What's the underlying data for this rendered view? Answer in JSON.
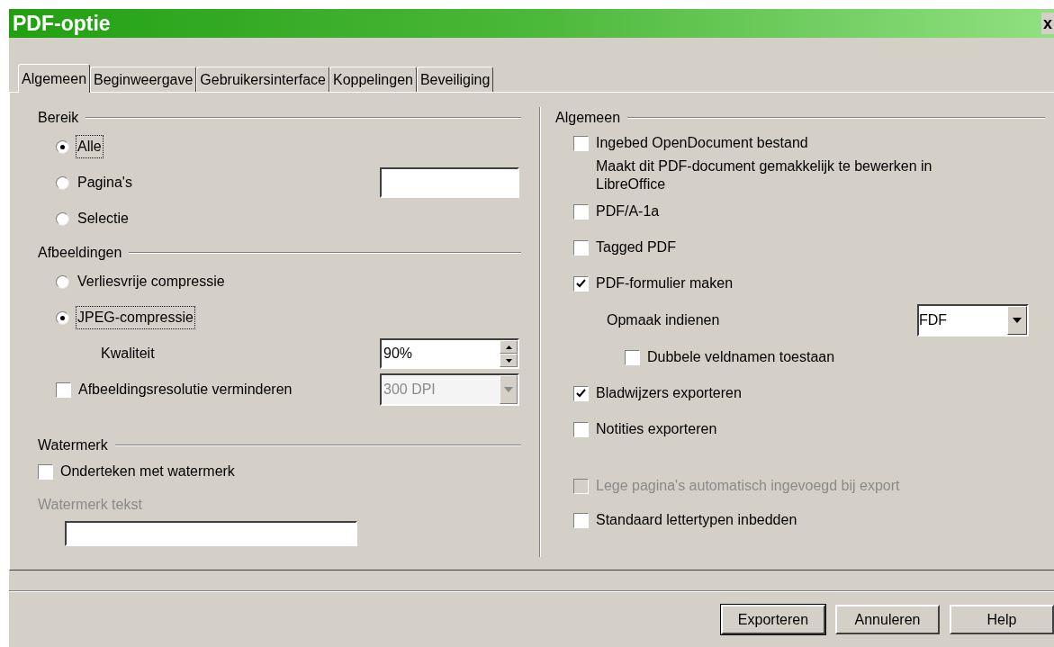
{
  "window": {
    "title": "PDF-optie",
    "close": "x"
  },
  "tabs": [
    {
      "label": "Algemeen",
      "selected": true
    },
    {
      "label": "Beginweergave",
      "selected": false
    },
    {
      "label": "Gebruikersinterface",
      "selected": false
    },
    {
      "label": "Koppelingen",
      "selected": false
    },
    {
      "label": "Beveiliging",
      "selected": false
    }
  ],
  "range": {
    "heading": "Bereik",
    "options": [
      {
        "label": "Alle",
        "selected": true
      },
      {
        "label": "Pagina's",
        "selected": false,
        "field": true
      },
      {
        "label": "Selectie",
        "selected": false
      }
    ]
  },
  "images": {
    "heading": "Afbeeldingen",
    "options": [
      {
        "label": "Verliesvrije compressie",
        "selected": false
      },
      {
        "label": "JPEG-compressie",
        "selected": true
      }
    ],
    "quality": {
      "label": "Kwaliteit",
      "value": "90%"
    },
    "resolution": {
      "label": "Afbeeldingsresolutie verminderen",
      "checked": false,
      "value": "300 DPI",
      "disabled": true
    }
  },
  "watermark": {
    "heading": "Watermerk",
    "sign": {
      "label": "Onderteken met watermerk",
      "checked": false
    },
    "text_label": "Watermerk tekst",
    "disabled": true
  },
  "general": {
    "heading": "Algemeen",
    "items": [
      {
        "label": "Ingebed OpenDocument bestand",
        "checked": false,
        "disabled": false,
        "description": "Maakt dit PDF-document gemakkelijk te bewerken in LibreOffice"
      },
      {
        "label": "PDF/A-1a",
        "checked": false,
        "disabled": false
      },
      {
        "label": "Tagged PDF",
        "checked": false,
        "disabled": false
      },
      {
        "label": "PDF-formulier maken",
        "checked": true,
        "disabled": false,
        "children": [
          {
            "kind": "dropdown",
            "label": "Opmaak indienen",
            "value": "FDF"
          },
          {
            "kind": "checkbox",
            "label": "Dubbele veldnamen toestaan",
            "checked": false
          }
        ]
      },
      {
        "label": "Bladwijzers exporteren",
        "checked": true,
        "disabled": false
      },
      {
        "label": "Notities exporteren",
        "checked": false,
        "disabled": false
      }
    ],
    "more_items": [
      {
        "label": "Lege pagina's automatisch ingevoegd bij export",
        "checked": false,
        "disabled": true
      },
      {
        "label": "Standaard lettertypen inbedden",
        "checked": false,
        "disabled": false
      }
    ]
  },
  "buttons": [
    {
      "label": "Exporteren",
      "default": true
    },
    {
      "label": "Annuleren",
      "default": false
    },
    {
      "label": "Help",
      "default": false
    }
  ]
}
